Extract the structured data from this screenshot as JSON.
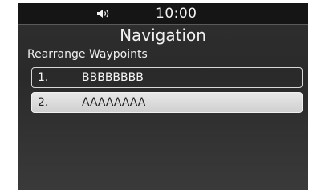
{
  "status_bar": {
    "volume_icon": "speaker-volume-icon",
    "time": "10:00"
  },
  "header": {
    "title": "Navigation",
    "subtitle": "Rearrange Waypoints"
  },
  "waypoints": [
    {
      "number": "1.",
      "name": "BBBBBBBB",
      "selected": false
    },
    {
      "number": "2.",
      "name": "AAAAAAAA",
      "selected": true
    }
  ],
  "colors": {
    "background": "#2f2f2f",
    "status_bar": "#151515",
    "text": "#f2f2f2",
    "selected_row": "#d8d8d8"
  }
}
